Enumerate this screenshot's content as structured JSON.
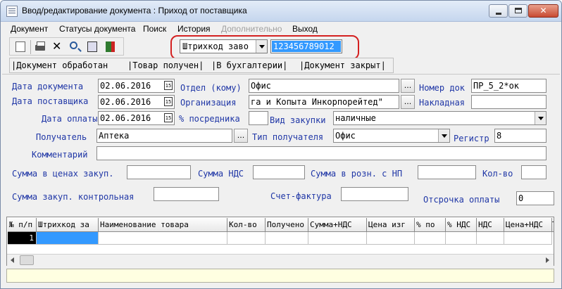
{
  "window": {
    "title": "Ввод/редактирование документа : Приход от поставщика",
    "close_glyph": "✕"
  },
  "menu": {
    "items": [
      {
        "label": "Документ",
        "enabled": true
      },
      {
        "label": "Статусы документа",
        "enabled": true
      },
      {
        "label": "Поиск",
        "enabled": true
      },
      {
        "label": "История",
        "enabled": true
      },
      {
        "label": "Дополнительно",
        "enabled": false
      },
      {
        "label": "Выход",
        "enabled": true
      }
    ]
  },
  "toolbar": {
    "icons": [
      "new-document-icon",
      "print-icon",
      "delete-icon",
      "search-icon",
      "edit-icon",
      "exit-icon"
    ],
    "delete_glyph": "✕"
  },
  "barcode": {
    "mode": "Штрихкод заво",
    "value": "123456789012"
  },
  "status_buttons": {
    "processed": "|Документ обработан",
    "received": "|Товар получен|",
    "accounting": "|В бухгалтерии|",
    "closed": "|Документ закрыт|"
  },
  "form": {
    "doc_date": {
      "label": "Дата документа",
      "value": "02.06.2016"
    },
    "supplier_date": {
      "label": "Дата поставщика",
      "value": "02.06.2016"
    },
    "payment_date": {
      "label": "Дата оплаты",
      "value": "02.06.2016"
    },
    "calendar_glyph": "15",
    "department": {
      "label": "Отдел (кому)",
      "value": "Офис"
    },
    "organization": {
      "label": "Организация",
      "value": "га и Копыта Инкорпорейтед\""
    },
    "intermediary": {
      "label": "% посредника",
      "value": ""
    },
    "doc_number": {
      "label": "Номер док",
      "value": "ПР_5_2*ок"
    },
    "invoice": {
      "label": "Накладная",
      "value": ""
    },
    "purchase_type": {
      "label": "Вид закупки",
      "value": "наличные"
    },
    "recipient": {
      "label": "Получатель",
      "value": "Аптека"
    },
    "recipient_type": {
      "label": "Тип получателя",
      "value": "Офис"
    },
    "register": {
      "label": "Регистр",
      "value": "8"
    },
    "comment": {
      "label": "Комментарий",
      "value": ""
    },
    "sum_purchase": {
      "label": "Сумма в ценах закуп.",
      "value": ""
    },
    "sum_vat": {
      "label": "Сумма НДС",
      "value": ""
    },
    "sum_retail": {
      "label": "Сумма в розн. с НП",
      "value": ""
    },
    "quantity": {
      "label": "Кол-во",
      "value": ""
    },
    "sum_control": {
      "label": "Сумма закуп. контрольная",
      "value": ""
    },
    "invoice_factura": {
      "label": "Счет-фактура",
      "value": ""
    },
    "payment_delay": {
      "label": "Отсрочка оплаты",
      "value": "0"
    },
    "ellipsis": "..."
  },
  "grid": {
    "columns": [
      "№ п/п",
      "Штрихкод за",
      "Наименование   товара",
      "Кол-во",
      "Получено",
      "Сумма+НДС",
      "Цена изг",
      "% по",
      "% НДС",
      "НДС",
      "Цена+НДС",
      "Т"
    ],
    "rows": [
      {
        "num": "1"
      }
    ]
  }
}
